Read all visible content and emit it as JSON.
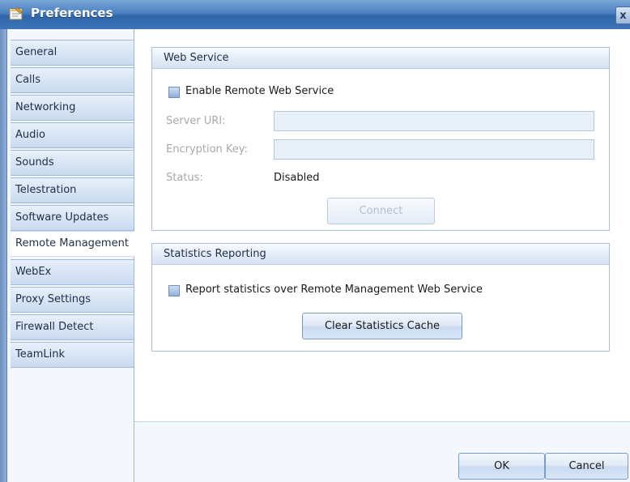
{
  "window": {
    "title": "Preferences",
    "title_icon": "preferences-icon",
    "close_glyph": "x"
  },
  "sidebar": {
    "items": [
      {
        "label": "General"
      },
      {
        "label": "Calls"
      },
      {
        "label": "Networking"
      },
      {
        "label": "Audio"
      },
      {
        "label": "Sounds"
      },
      {
        "label": "Telestration"
      },
      {
        "label": "Software Updates"
      },
      {
        "label": "Remote Management",
        "active": true
      },
      {
        "label": "WebEx"
      },
      {
        "label": "Proxy Settings"
      },
      {
        "label": "Firewall Detect"
      },
      {
        "label": "TeamLink"
      }
    ]
  },
  "web_service": {
    "title": "Web Service",
    "enable_label": "Enable Remote Web Service",
    "server_uri_label": "Server URI:",
    "server_uri_value": "",
    "encryption_key_label": "Encryption Key:",
    "encryption_key_value": "",
    "status_label": "Status:",
    "status_value": "Disabled",
    "connect_label": "Connect"
  },
  "statistics": {
    "title": "Statistics Reporting",
    "report_label": "Report statistics over Remote Management Web Service",
    "clear_label": "Clear Statistics Cache"
  },
  "footer": {
    "ok_label": "OK",
    "cancel_label": "Cancel"
  },
  "colors": {
    "titlebar": "#3d74b8",
    "accent": "#7b9cc7",
    "sidebar_tab": "#c9daf0",
    "disabled_text": "#a8a8a8"
  }
}
